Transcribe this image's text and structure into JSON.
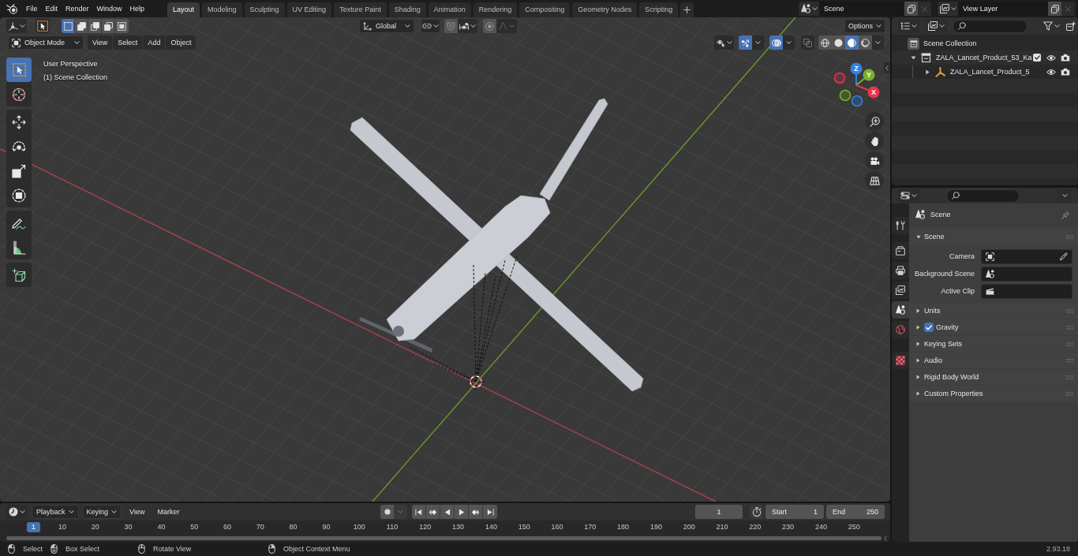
{
  "top_bar": {
    "menus": [
      "File",
      "Edit",
      "Render",
      "Window",
      "Help"
    ],
    "workspace_tabs": [
      {
        "label": "Layout",
        "selected": true
      },
      {
        "label": "Modeling",
        "selected": false
      },
      {
        "label": "Sculpting",
        "selected": false
      },
      {
        "label": "UV Editing",
        "selected": false
      },
      {
        "label": "Texture Paint",
        "selected": false
      },
      {
        "label": "Shading",
        "selected": false
      },
      {
        "label": "Animation",
        "selected": false
      },
      {
        "label": "Rendering",
        "selected": false
      },
      {
        "label": "Compositing",
        "selected": false
      },
      {
        "label": "Geometry Nodes",
        "selected": false
      },
      {
        "label": "Scripting",
        "selected": false
      }
    ],
    "scene": "Scene",
    "view_layer": "View Layer"
  },
  "viewport": {
    "select_modes": [
      {
        "kind": "set",
        "selected": true
      },
      {
        "kind": "extend",
        "selected": false
      },
      {
        "kind": "subtract",
        "selected": false
      },
      {
        "kind": "difference",
        "selected": false
      },
      {
        "kind": "intersect",
        "selected": false
      }
    ],
    "orientation": "Global",
    "snap": {
      "on": false
    },
    "proportional_editing": {
      "on": false
    },
    "options": "Options",
    "mode": "Object Mode",
    "menus": [
      "View",
      "Select",
      "Add",
      "Object"
    ],
    "gizmos": {
      "on": true
    },
    "overlays": {
      "on": true
    },
    "xray": {
      "on": false
    },
    "shading": [
      {
        "kind": "wireframe",
        "selected": false
      },
      {
        "kind": "solid",
        "selected": false
      },
      {
        "kind": "material",
        "selected": true
      },
      {
        "kind": "rendered",
        "selected": false
      }
    ],
    "info": [
      "User Perspective",
      "(1) Scene Collection"
    ],
    "toolbar": [
      {
        "tools": [
          {
            "kind": "select_box",
            "selected": true
          },
          {
            "kind": "cursor",
            "selected": false
          }
        ]
      },
      {
        "tools": [
          {
            "kind": "move",
            "selected": false
          },
          {
            "kind": "rotate",
            "selected": false
          },
          {
            "kind": "scale",
            "selected": false
          },
          {
            "kind": "transform",
            "selected": false
          }
        ]
      },
      {
        "tools": [
          {
            "kind": "annotate",
            "selected": false
          },
          {
            "kind": "measure",
            "selected": false
          }
        ]
      },
      {
        "tools": [
          {
            "kind": "add_cube",
            "selected": false
          }
        ]
      }
    ],
    "axes": [
      {
        "label": "Z",
        "color": "#2e83e6"
      },
      {
        "label": "Y",
        "color": "#79b128"
      },
      {
        "label": "X",
        "color": "#e8344c"
      }
    ]
  },
  "timeline": {
    "menus": [
      {
        "label": "Playback",
        "kind": "dropdown"
      },
      {
        "label": "Keying",
        "kind": "dropdown"
      },
      {
        "label": "View",
        "kind": "menu"
      },
      {
        "label": "Marker",
        "kind": "menu"
      }
    ],
    "current_frame": "1",
    "start": {
      "label": "Start",
      "value": "1"
    },
    "end": {
      "label": "End",
      "value": "250"
    },
    "playhead": "1",
    "ruler": [
      "10",
      "20",
      "30",
      "40",
      "50",
      "60",
      "70",
      "80",
      "90",
      "100",
      "110",
      "120",
      "130",
      "140",
      "150",
      "160",
      "170",
      "180",
      "190",
      "200",
      "210",
      "220",
      "230",
      "240",
      "250"
    ]
  },
  "outliner": {
    "root": "Scene Collection",
    "items": [
      {
        "label": "ZALA_Lancet_Product_53_Ka",
        "kind": "collection",
        "expanded": true,
        "checked": true,
        "visible": true,
        "renderable": true,
        "children": [
          {
            "label": "ZALA_Lancet_Product_5",
            "kind": "empty",
            "expanded": false,
            "visible": true,
            "renderable": true
          }
        ]
      }
    ]
  },
  "properties": {
    "tab_groups": [
      {
        "tabs": [
          {
            "kind": "tool",
            "selected": false
          }
        ]
      },
      {
        "tabs": [
          {
            "kind": "render",
            "selected": false
          },
          {
            "kind": "output",
            "selected": false
          },
          {
            "kind": "view_layer",
            "selected": false
          },
          {
            "kind": "scene",
            "selected": true
          },
          {
            "kind": "world",
            "selected": false
          }
        ]
      },
      {
        "tabs": [
          {
            "kind": "texture",
            "selected": false
          }
        ]
      }
    ],
    "context": "Scene",
    "panels": [
      {
        "title": "Scene",
        "kind": "plain",
        "expanded": true,
        "fields": [
          {
            "label": "Camera",
            "kind": "object"
          },
          {
            "label": "Background Scene",
            "kind": "scene"
          },
          {
            "label": "Active Clip",
            "kind": "clip"
          }
        ]
      },
      {
        "title": "Units",
        "kind": "plain",
        "expanded": false
      },
      {
        "title": "Gravity",
        "kind": "checkbox",
        "checked": true,
        "expanded": false
      },
      {
        "title": "Keying Sets",
        "kind": "plain",
        "expanded": false
      },
      {
        "title": "Audio",
        "kind": "plain",
        "expanded": false
      },
      {
        "title": "Rigid Body World",
        "kind": "plain",
        "expanded": false
      },
      {
        "title": "Custom Properties",
        "kind": "plain",
        "expanded": false
      }
    ]
  },
  "status_bar": {
    "hints": [
      {
        "kind": "left_click",
        "label": "Select"
      },
      {
        "kind": "left_drag",
        "label": "Box Select"
      },
      {
        "kind": "middle_click",
        "label": "Rotate View"
      },
      {
        "kind": "right_click",
        "label": "Object Context Menu"
      }
    ],
    "version": "2.93.18"
  }
}
